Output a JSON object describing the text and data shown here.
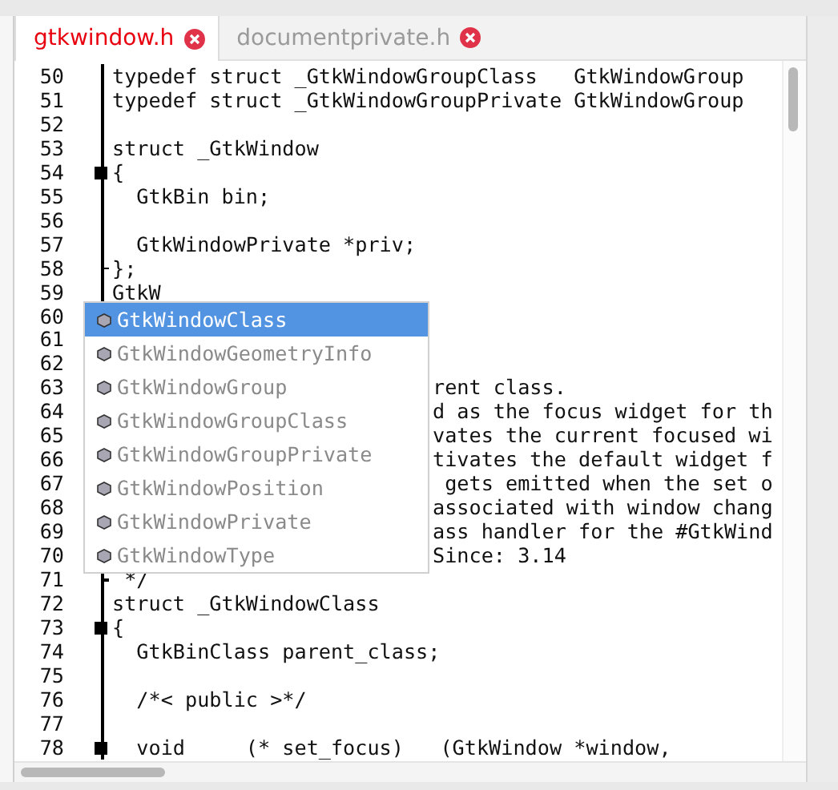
{
  "tabs": [
    {
      "label": "gtkwindow.h",
      "selected": true
    },
    {
      "label": "documentprivate.h",
      "selected": false
    }
  ],
  "lines": [
    {
      "number": "50",
      "text": "typedef struct _GtkWindowGroupClass   GtkWindowGroup",
      "kind": "code"
    },
    {
      "number": "51",
      "text": "typedef struct _GtkWindowGroupPrivate GtkWindowGroup",
      "kind": "code"
    },
    {
      "number": "52"
    },
    {
      "number": "53",
      "text": "struct _GtkWindow",
      "kind": "code"
    },
    {
      "number": "54",
      "text": "{",
      "kind": "code",
      "fold_start": true
    },
    {
      "number": "55",
      "text": "  GtkBin bin;",
      "kind": "code"
    },
    {
      "number": "56"
    },
    {
      "number": "57",
      "text": "  GtkWindowPrivate *priv;",
      "kind": "code"
    },
    {
      "number": "58",
      "text": "};",
      "kind": "code",
      "fold_end": true
    },
    {
      "number": "59",
      "text": "GtkW",
      "kind": "code"
    },
    {
      "number": "60"
    },
    {
      "number": "61"
    },
    {
      "number": "62"
    },
    {
      "number": "63",
      "text": "rent class.",
      "kind": "behind_popup"
    },
    {
      "number": "64",
      "text": "d as the focus widget for th",
      "kind": "behind_popup"
    },
    {
      "number": "65",
      "text": "vates the current focused wi",
      "kind": "behind_popup"
    },
    {
      "number": "66",
      "text": "tivates the default widget f",
      "kind": "behind_popup"
    },
    {
      "number": "67",
      "text": " gets emitted when the set o",
      "kind": "behind_popup"
    },
    {
      "number": "68",
      "text": "associated with window chang",
      "kind": "behind_popup"
    },
    {
      "number": "69",
      "text": "ass handler for the #GtkWind",
      "kind": "behind_popup"
    },
    {
      "number": "70",
      "text": "Since: 3.14",
      "kind": "behind_popup"
    },
    {
      "number": "71",
      "text": " */",
      "kind": "code",
      "fold_end": true
    },
    {
      "number": "72",
      "text": "struct _GtkWindowClass",
      "kind": "code"
    },
    {
      "number": "73",
      "text": "{",
      "kind": "code",
      "fold_start": true
    },
    {
      "number": "74",
      "text": "  GtkBinClass parent_class;",
      "kind": "code"
    },
    {
      "number": "75"
    },
    {
      "number": "76",
      "text": "  /*< public >*/",
      "kind": "code"
    },
    {
      "number": "77"
    },
    {
      "number": "78",
      "text": "  void     (* set_focus)   (GtkWindow *window,",
      "kind": "code",
      "fold_start": true
    }
  ],
  "completion": {
    "items": [
      {
        "label": "GtkWindowClass",
        "selected": true
      },
      {
        "label": "GtkWindowGeometryInfo",
        "selected": false
      },
      {
        "label": "GtkWindowGroup",
        "selected": false
      },
      {
        "label": "GtkWindowGroupClass",
        "selected": false
      },
      {
        "label": "GtkWindowGroupPrivate",
        "selected": false
      },
      {
        "label": "GtkWindowPosition",
        "selected": false
      },
      {
        "label": "GtkWindowPrivate",
        "selected": false
      },
      {
        "label": "GtkWindowType",
        "selected": false
      }
    ]
  }
}
